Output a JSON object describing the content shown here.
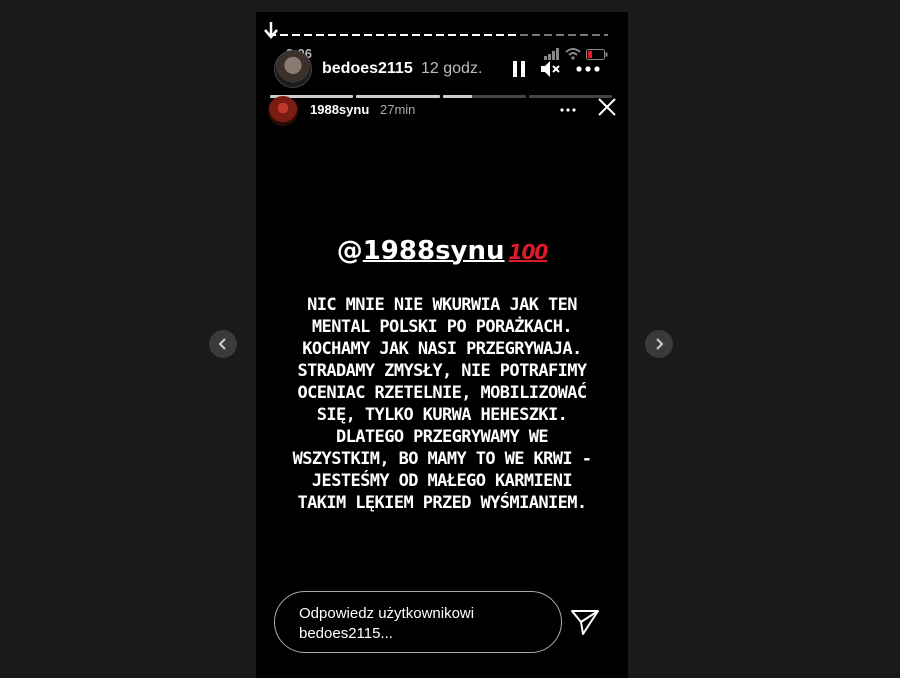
{
  "nav": {
    "prev_icon": "chevron-left-icon",
    "next_icon": "chevron-right-icon"
  },
  "outer_story": {
    "status_time": "3:06",
    "username": "bedoes2115",
    "age": "12 godz.",
    "progress_fraction": 0.74,
    "segments": [
      "done",
      "done",
      "partial",
      "empty"
    ]
  },
  "inner_story": {
    "username": "1988synu",
    "age": "27min"
  },
  "content": {
    "mention_at": "@",
    "mention_handle": "1988synu",
    "mention_emoji": "100",
    "lines": [
      "NIC MNIE NIE WKURWIA JAK TEN",
      "MENTAL POLSKI PO PORAŻKACH.",
      "KOCHAMY JAK NASI PRZEGRYWAJA.",
      "STRADAMY ZMYSŁY, NIE POTRAFIMY",
      "OCENIAC RZETELNIE, MOBILIZOWAĆ",
      "SIĘ, TYLKO KURWA HEHESZKI.",
      "DLATEGO PRZEGRYWAMY WE",
      "WSZYSTKIM, BO MAMY TO WE KRWI -",
      "JESTEŚMY OD MAŁEGO KARMIENI",
      "TAKIM LĘKIEM PRZED WYŚMIANIEM."
    ]
  },
  "reply": {
    "placeholder_line1": "Odpowiedz użytkownikowi",
    "placeholder_line2": "bedoes2115..."
  },
  "colors": {
    "background": "#1a1a1a",
    "story_bg": "#000000",
    "emoji_red": "#e0192b"
  }
}
